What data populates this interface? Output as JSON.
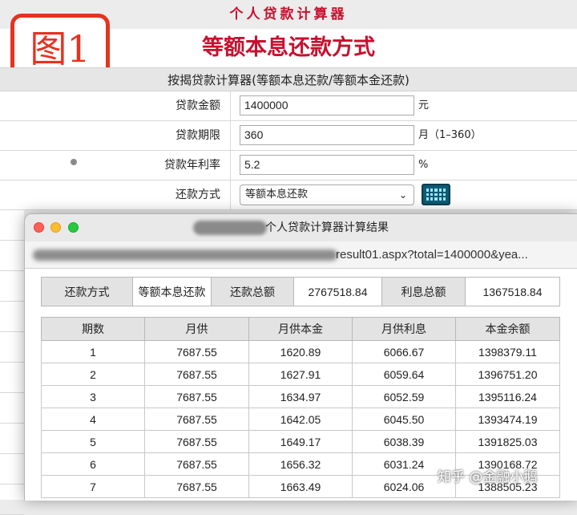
{
  "page": {
    "top_title": "个人贷款计算器",
    "figure_label": "图1",
    "subtitle": "等额本息还款方式",
    "calc_title": "按揭贷款计算器(等额本息还款/等额本金还款)"
  },
  "form": {
    "amount": {
      "label": "贷款金额",
      "value": "1400000",
      "unit": "元"
    },
    "term": {
      "label": "贷款期限",
      "value": "360",
      "unit": "月（1–360）"
    },
    "rate": {
      "label": "贷款年利率",
      "value": "5.2",
      "unit": "%"
    },
    "method": {
      "label": "还款方式",
      "selected": "等额本息还款"
    },
    "calculate_icon": "calculator-icon"
  },
  "result_window": {
    "title": "个人贷款计算器计算结果",
    "url_tail": "result01.aspx?total=1400000&yea...",
    "summary": {
      "method_label": "还款方式",
      "method_value": "等额本息还款",
      "total_label": "还款总额",
      "total_value": "2767518.84",
      "interest_label": "利息总额",
      "interest_value": "1367518.84"
    },
    "table": {
      "headers": [
        "期数",
        "月供",
        "月供本金",
        "月供利息",
        "本金余额"
      ],
      "rows": [
        [
          "1",
          "7687.55",
          "1620.89",
          "6066.67",
          "1398379.11"
        ],
        [
          "2",
          "7687.55",
          "1627.91",
          "6059.64",
          "1396751.20"
        ],
        [
          "3",
          "7687.55",
          "1634.97",
          "6052.59",
          "1395116.24"
        ],
        [
          "4",
          "7687.55",
          "1642.05",
          "6045.50",
          "1393474.19"
        ],
        [
          "5",
          "7687.55",
          "1649.17",
          "6038.39",
          "1391825.03"
        ],
        [
          "6",
          "7687.55",
          "1656.32",
          "6031.24",
          "1390168.72"
        ],
        [
          "7",
          "7687.55",
          "1663.49",
          "6024.06",
          "1388505.23"
        ]
      ]
    }
  },
  "watermark": "知乎 @金融小鹅",
  "colors": {
    "title_red": "#c8102e",
    "figure_border": "#e53320",
    "header_gray": "#e3e3e3"
  }
}
